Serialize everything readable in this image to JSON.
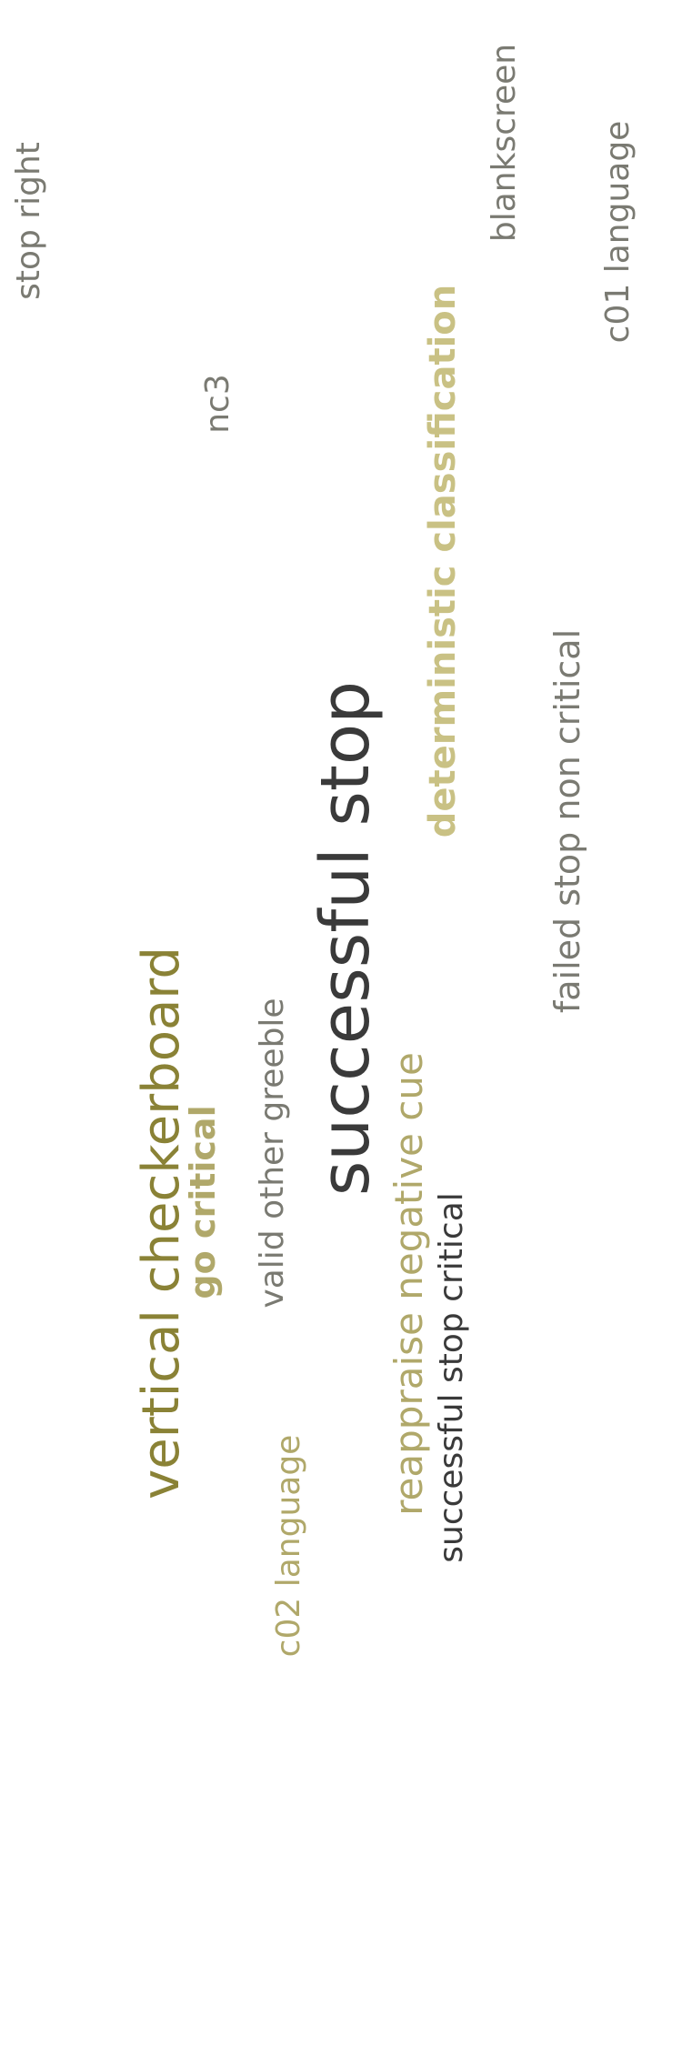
{
  "colors": {
    "dark_gray": "#3a3a3a",
    "mid_gray": "#7a7a72",
    "olive": "#8a8236",
    "olive_light": "#b0a86a",
    "khaki": "#c9c184"
  },
  "words": {
    "stop_right": "stop right",
    "blankscreen": "blankscreen",
    "c01_language": "c01 language",
    "nc3": "nc3",
    "deterministic_classification": "deterministic classification",
    "successful_stop": "successful stop",
    "failed_stop_non_critical": "failed stop non critical",
    "vertical_checkerboard": "vertical checkerboard",
    "go_critical": "go critical",
    "valid_other_greeble": "valid other greeble",
    "reappraise_negative_cue": "reappraise negative cue",
    "successful_stop_critical": "successful stop critical",
    "c02_language": "c02 language"
  }
}
